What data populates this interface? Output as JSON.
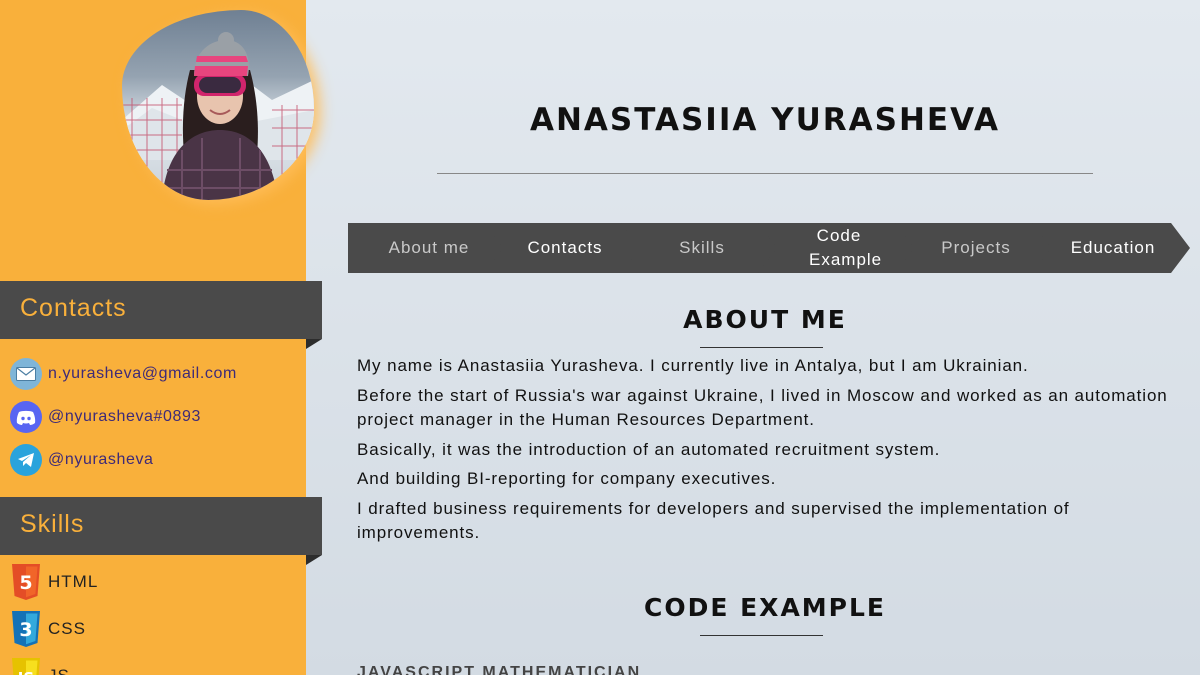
{
  "profile": {
    "name": "ANASTASIIA YURASHEVA"
  },
  "nav": {
    "items": [
      {
        "label": "About me",
        "style": "dim"
      },
      {
        "label": "Contacts",
        "style": "bright"
      },
      {
        "label": "Skills",
        "style": "dim"
      },
      {
        "label": "Code Example",
        "style": "bright"
      },
      {
        "label": "Projects",
        "style": "dim"
      },
      {
        "label": "Education",
        "style": "bright"
      }
    ]
  },
  "sidebar": {
    "contacts_title": "Contacts",
    "contacts": [
      {
        "icon": "email-icon",
        "text": "n.yurasheva@gmail.com",
        "color": "#7fb5d8"
      },
      {
        "icon": "discord-icon",
        "text": "@nyurasheva#0893",
        "color": "#5865f2"
      },
      {
        "icon": "telegram-icon",
        "text": "@nyurasheva",
        "color": "#2aa3dc"
      }
    ],
    "skills_title": "Skills",
    "skills": [
      {
        "icon": "html5-icon",
        "text": "HTML",
        "color": "#e44d26"
      },
      {
        "icon": "css3-icon",
        "text": "CSS",
        "color": "#1572b6"
      },
      {
        "icon": "js-icon",
        "text": "JS",
        "color": "#f7df1e"
      }
    ]
  },
  "about": {
    "title": "ABOUT ME",
    "paragraphs": [
      "My name is Anastasiia Yurasheva. I currently live in Antalya, but I am Ukrainian.",
      "Before the start of Russia's war against Ukraine, I lived in Moscow and worked as an automation project manager in the Human Resources Department.",
      "Basically, it was the introduction of an automated recruitment system.",
      "And building BI-reporting for company executives.",
      "I drafted business requirements for developers and supervised the implementation of improvements."
    ]
  },
  "code": {
    "title": "CODE EXAMPLE",
    "subheading": "JAVASCRIPT MATHEMATICIAN"
  },
  "colors": {
    "accent": "#f9b03b",
    "panel": "#4a4a4a",
    "contact_text": "#3e2a78"
  }
}
